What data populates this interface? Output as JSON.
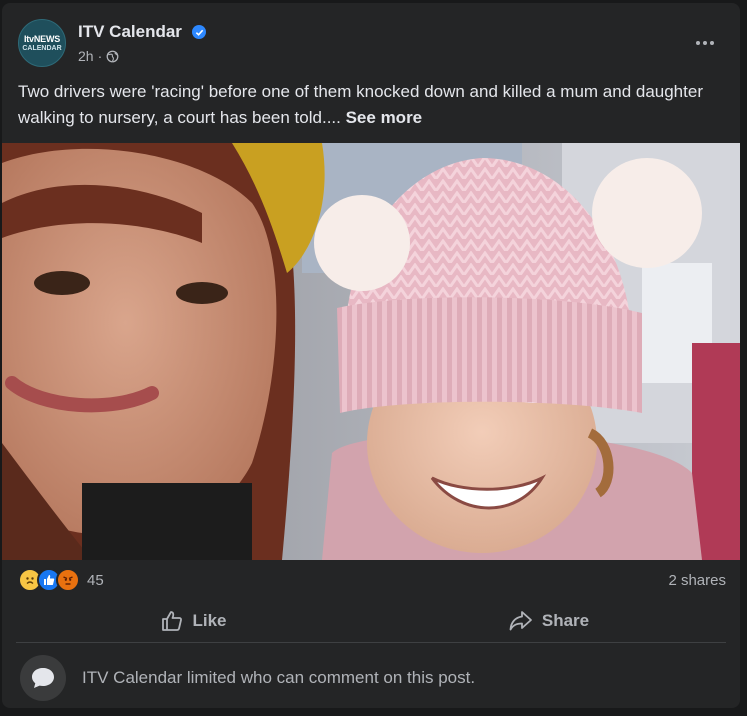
{
  "post": {
    "page_name": "ITV Calendar",
    "avatar_line1": "ItvNEWS",
    "avatar_line2": "CALENDAR",
    "time": "2h",
    "body": "Two drivers were 'racing' before one of them knocked down and killed a mum and daughter walking to nursery, a court has been told....",
    "see_more": "See more"
  },
  "stats": {
    "reaction_icons": [
      "sad-reaction",
      "like-reaction",
      "angry-reaction"
    ],
    "reaction_count": "45",
    "shares": "2 shares"
  },
  "actions": {
    "like_label": "Like",
    "share_label": "Share"
  },
  "comments": {
    "notice": "ITV Calendar limited who can comment on this post."
  },
  "colors": {
    "card": "#242526",
    "text": "#e4e6eb",
    "muted": "#b0b3b8",
    "verified": "#2d88ff"
  }
}
